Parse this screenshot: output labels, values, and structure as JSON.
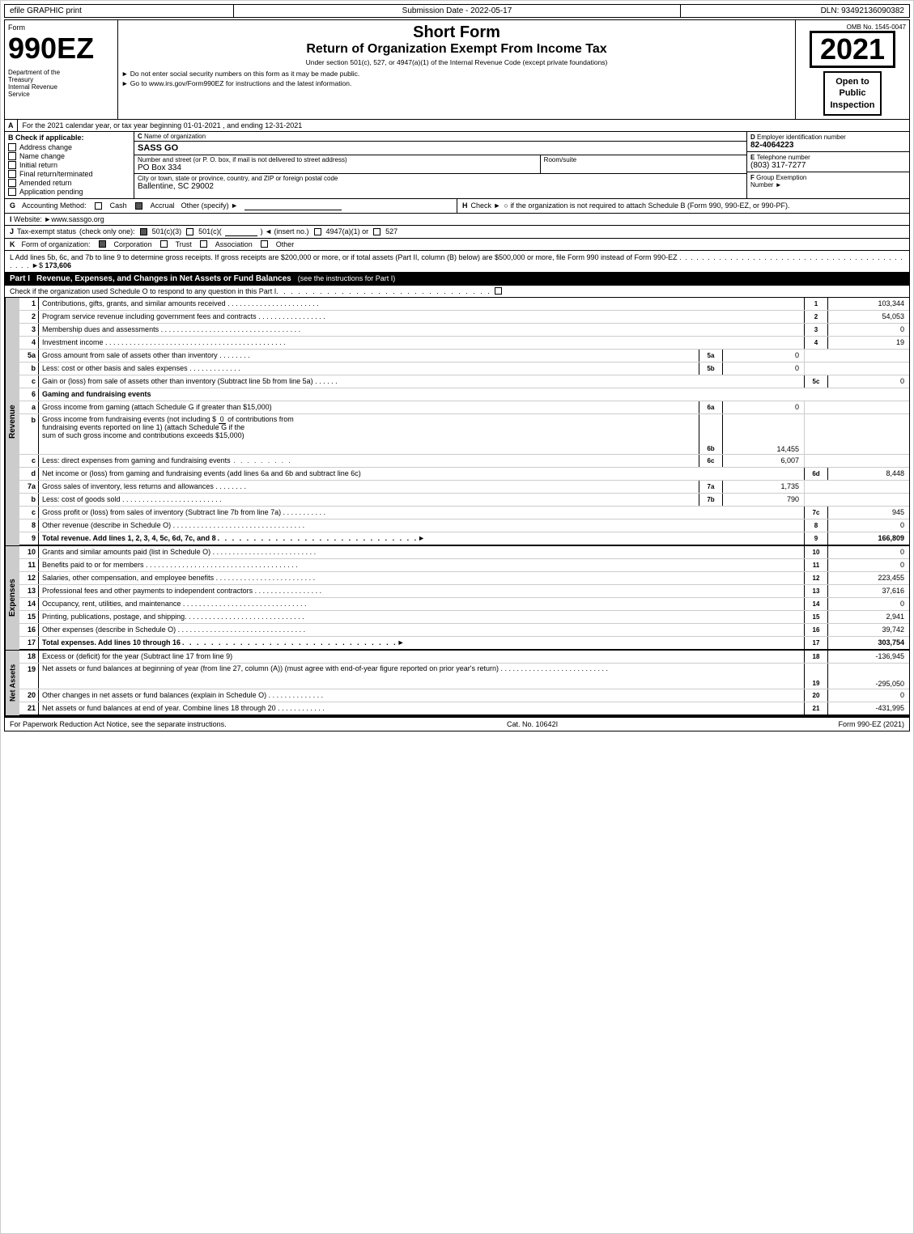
{
  "header": {
    "top_left": "efile GRAPHIC print",
    "top_mid": "Submission Date - 2022-05-17",
    "top_right": "DLN: 93492136090382",
    "form_label": "Form",
    "form_number": "990EZ",
    "dept1": "Department of the",
    "dept2": "Treasury",
    "dept3": "Internal Revenue",
    "dept4": "Service",
    "title_main": "Short Form",
    "title_sub": "Return of Organization Exempt From Income Tax",
    "title_note1": "Under section 501(c), 527, or 4947(a)(1) of the Internal Revenue Code (except private foundations)",
    "title_note2": "► Do not enter social security numbers on this form as it may be made public.",
    "title_note3": "► Go to www.irs.gov/Form990EZ for instructions and the latest information.",
    "year": "2021",
    "omb": "OMB No. 1545-0047",
    "open_line1": "Open to",
    "open_line2": "Public",
    "open_line3": "Inspection"
  },
  "sectionA": {
    "label": "A",
    "text": "For the 2021 calendar year, or tax year beginning 01-01-2021 , and ending 12-31-2021"
  },
  "sectionB": {
    "label": "B",
    "sublabel": "Check if applicable:",
    "items": [
      {
        "id": "address_change",
        "label": "Address change",
        "checked": false
      },
      {
        "id": "name_change",
        "label": "Name change",
        "checked": false
      },
      {
        "id": "initial_return",
        "label": "Initial return",
        "checked": false
      },
      {
        "id": "final_return",
        "label": "Final return/terminated",
        "checked": false
      },
      {
        "id": "amended_return",
        "label": "Amended return",
        "checked": false
      },
      {
        "id": "application_pending",
        "label": "Application pending",
        "checked": false
      }
    ]
  },
  "sectionC": {
    "label": "C",
    "name_label": "Name of organization",
    "name_value": "SASS GO",
    "address_label": "Number and street (or P. O. box, if mail is not delivered to street address)",
    "address_value": "PO Box 334",
    "room_label": "Room/suite",
    "room_value": "",
    "city_label": "City or town, state or province, country, and ZIP or foreign postal code",
    "city_value": "Ballentine, SC  29002"
  },
  "sectionD": {
    "label": "D",
    "text": "Employer identification number",
    "ein": "82-4064223"
  },
  "sectionE": {
    "label": "E",
    "text": "Telephone number",
    "phone": "(803) 317-7277"
  },
  "sectionF": {
    "label": "F",
    "text1": "Group Exemption",
    "text2": "Number",
    "arrow": "►"
  },
  "sectionG": {
    "label": "G",
    "text": "Accounting Method:",
    "cash_label": "Cash",
    "accrual_label": "Accrual",
    "accrual_checked": true,
    "other_label": "Other (specify) ►",
    "other_line": "_______________"
  },
  "sectionH": {
    "label": "H",
    "text": "Check ►",
    "text2": "○ if the organization is not required to attach Schedule B (Form 990, 990-EZ, or 990-PF)."
  },
  "sectionI": {
    "label": "I",
    "text": "Website: ►www.sassgo.org"
  },
  "sectionJ": {
    "label": "J",
    "text": "Tax-exempt status",
    "note": "(check only one):",
    "c3_checked": true,
    "c3": "501(c)(3)",
    "cc": "501(c)(",
    "insert_no": ") ◄ (insert no.)",
    "c4947": "4947(a)(1) or",
    "c527": "527"
  },
  "sectionK": {
    "label": "K",
    "text": "Form of organization:",
    "corp_label": "Corporation",
    "corp_checked": true,
    "trust_label": "Trust",
    "assoc_label": "Association",
    "other_label": "Other"
  },
  "sectionL": {
    "text": "L Add lines 5b, 6c, and 7b to line 9 to determine gross receipts. If gross receipts are $200,000 or more, or if total assets (Part II, column (B) below) are $500,000 or more, file Form 990 instead of Form 990-EZ",
    "dots": ". . . . . . . . . . . . . . . . . . . . . . . . . . . . . . . . . . . . . . . . . . . .",
    "arrow": "►$",
    "value": "173,606"
  },
  "partI": {
    "label": "Part I",
    "title": "Revenue, Expenses, and Changes in Net Assets or Fund Balances",
    "note": "(see the instructions for Part I)",
    "check_note": "Check if the organization used Schedule O to respond to any question in this Part I",
    "check_dots": ". . . . . . . . . . . . . . . . . . . . . . . . . . . . . .",
    "rows": [
      {
        "num": "1",
        "desc": "Contributions, gifts, grants, and similar amounts received . . . . . . . . . . . . . . . . . . . . . . .",
        "line_label": "1",
        "amount": "103,344"
      },
      {
        "num": "2",
        "desc": "Program service revenue including government fees and contracts . . . . . . . . . . . . . . . . .",
        "line_label": "2",
        "amount": "54,053"
      },
      {
        "num": "3",
        "desc": "Membership dues and assessments . . . . . . . . . . . . . . . . . . . . . . . . . . . . . . . . . . .",
        "line_label": "3",
        "amount": "0"
      },
      {
        "num": "4",
        "desc": "Investment income . . . . . . . . . . . . . . . . . . . . . . . . . . . . . . . . . . . . . . . . . . . . .",
        "line_label": "4",
        "amount": "19"
      }
    ],
    "row5a": {
      "num": "5a",
      "desc": "Gross amount from sale of assets other than inventory . . . . . . . .",
      "mid_label": "5a",
      "mid_val": "0"
    },
    "row5b": {
      "num": "b",
      "desc": "Less: cost or other basis and sales expenses . . . . . . . . . . . . .",
      "mid_label": "5b",
      "mid_val": "0"
    },
    "row5c": {
      "num": "c",
      "desc": "Gain or (loss) from sale of assets other than inventory (Subtract line 5b from line 5a) . . . . . .",
      "line_label": "5c",
      "amount": "0"
    },
    "row6": {
      "num": "6",
      "desc": "Gaming and fundraising events"
    },
    "row6a": {
      "num": "a",
      "desc": "Gross income from gaming (attach Schedule G if greater than $15,000)",
      "mid_label": "6a",
      "mid_val": "0"
    },
    "row6b_desc": "Gross income from fundraising events (not including $",
    "row6b_val": "0",
    "row6b_desc2": "of contributions from",
    "row6b_desc3": "fundraising events reported on line 1) (attach Schedule G if the",
    "row6b_desc4": "sum of such gross income and contributions exceeds $15,000)",
    "row6b_label": "6b",
    "row6b_amount": "14,455",
    "row6c_desc": "Less: direct expenses from gaming and fundraising events",
    "row6c_label": "6c",
    "row6c_amount": "6,007",
    "row6d": {
      "num": "d",
      "desc": "Net income or (loss) from gaming and fundraising events (add lines 6a and 6b and subtract line 6c)",
      "line_label": "6d",
      "amount": "8,448"
    },
    "row7a": {
      "num": "7a",
      "desc": "Gross sales of inventory, less returns and allowances . . . . . . . .",
      "mid_label": "7a",
      "mid_val": "1,735"
    },
    "row7b": {
      "num": "b",
      "desc": "Less: cost of goods sold . . . . . . . . . . . . . . . . . . . . . . . . .",
      "mid_label": "7b",
      "mid_val": "790"
    },
    "row7c": {
      "num": "c",
      "desc": "Gross profit or (loss) from sales of inventory (Subtract line 7b from line 7a) . . . . . . . . . . .",
      "line_label": "7c",
      "amount": "945"
    },
    "row8": {
      "num": "8",
      "desc": "Other revenue (describe in Schedule O) . . . . . . . . . . . . . . . . . . . . . . . . . . . . . . . . .",
      "line_label": "8",
      "amount": "0"
    },
    "row9": {
      "num": "9",
      "desc": "Total revenue. Add lines 1, 2, 3, 4, 5c, 6d, 7c, and 8",
      "dots": ". . . . . . . . . . . . . . . . . . . . . . . . . . . .",
      "arrow": "►",
      "line_label": "9",
      "amount": "166,809"
    }
  },
  "partI_expenses": {
    "rows": [
      {
        "num": "10",
        "desc": "Grants and similar amounts paid (list in Schedule O) . . . . . . . . . . . . . . . . . . . . . . . . . .",
        "line_label": "10",
        "amount": "0"
      },
      {
        "num": "11",
        "desc": "Benefits paid to or for members . . . . . . . . . . . . . . . . . . . . . . . . . . . . . . . . . . . . . .",
        "line_label": "11",
        "amount": "0"
      },
      {
        "num": "12",
        "desc": "Salaries, other compensation, and employee benefits . . . . . . . . . . . . . . . . . . . . . . . . .",
        "line_label": "12",
        "amount": "223,455"
      },
      {
        "num": "13",
        "desc": "Professional fees and other payments to independent contractors . . . . . . . . . . . . . . . . .",
        "line_label": "13",
        "amount": "37,616"
      },
      {
        "num": "14",
        "desc": "Occupancy, rent, utilities, and maintenance . . . . . . . . . . . . . . . . . . . . . . . . . . . . . . .",
        "line_label": "14",
        "amount": "0"
      },
      {
        "num": "15",
        "desc": "Printing, publications, postage, and shipping. . . . . . . . . . . . . . . . . . . . . . . . . . . . . .",
        "line_label": "15",
        "amount": "2,941"
      },
      {
        "num": "16",
        "desc": "Other expenses (describe in Schedule O) . . . . . . . . . . . . . . . . . . . . . . . . . . . . . . . .",
        "line_label": "16",
        "amount": "39,742"
      },
      {
        "num": "17",
        "desc": "Total expenses. Add lines 10 through 16",
        "dots": " . . . . . . . . . . . . . . . . . . . . . . . . . . . . . .",
        "arrow": "►",
        "line_label": "17",
        "amount": "303,754",
        "bold": true
      }
    ]
  },
  "partI_assets": {
    "rows": [
      {
        "num": "18",
        "desc": "Excess or (deficit) for the year (Subtract line 17 from line 9)",
        "dots": " . . . . . . . . . . . . . . . . . . . .",
        "line_label": "18",
        "amount": "-136,945"
      },
      {
        "num": "19",
        "desc": "Net assets or fund balances at beginning of year (from line 27, column (A)) (must agree with end-of-year figure reported on prior year's return) . . . . . . . . . . . . . . . . . . . . . . . . . . .",
        "line_label": "19",
        "amount": "-295,050"
      },
      {
        "num": "20",
        "desc": "Other changes in net assets or fund balances (explain in Schedule O) . . . . . . . . . . . . . .",
        "line_label": "20",
        "amount": "0"
      },
      {
        "num": "21",
        "desc": "Net assets or fund balances at end of year. Combine lines 18 through 20 . . . . . . . . . . . .",
        "line_label": "21",
        "amount": "-431,995"
      }
    ]
  },
  "footer": {
    "left": "For Paperwork Reduction Act Notice, see the separate instructions.",
    "mid": "Cat. No. 10642I",
    "right": "Form 990-EZ (2021)"
  },
  "revenue_label": "Revenue",
  "expenses_label": "Expenses",
  "net_assets_label": "Net Assets"
}
